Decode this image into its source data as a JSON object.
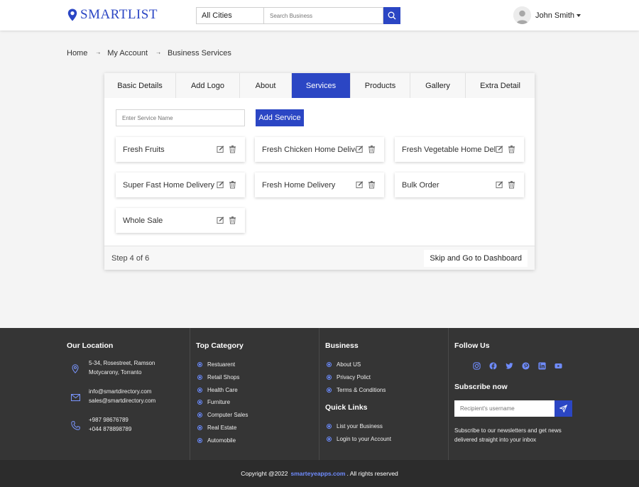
{
  "header": {
    "logo_text": "SMARTLIST",
    "city_select": "All Cities",
    "search_placeholder": "Search Business",
    "user_name": "John Smith"
  },
  "breadcrumb": [
    "Home",
    "My Account",
    "Business Services"
  ],
  "tabs": [
    {
      "label": "Basic Details",
      "active": false
    },
    {
      "label": "Add Logo",
      "active": false
    },
    {
      "label": "About",
      "active": false
    },
    {
      "label": "Services",
      "active": true
    },
    {
      "label": "Products",
      "active": false
    },
    {
      "label": "Gallery",
      "active": false
    },
    {
      "label": "Extra Detail",
      "active": false
    }
  ],
  "service_form": {
    "placeholder": "Enter Service Name",
    "add_label": "Add Service"
  },
  "services": [
    "Fresh Fruits",
    "Fresh Chicken Home Delivery",
    "Fresh Vegetable Home Delivery",
    "Super Fast Home Delivery",
    "Fresh Home Delivery",
    "Bulk Order",
    "Whole Sale"
  ],
  "card_footer": {
    "step": "Step 4 of 6",
    "skip_label": "Skip and Go to Dashboard"
  },
  "footer": {
    "location": {
      "heading": "Our Location",
      "address": [
        "5-34, Rosestreet, Ramson",
        "Motycarony, Torranto"
      ],
      "emails": [
        "info@smartdirectory.com",
        "sales@smartdirectory.com"
      ],
      "phones": [
        "+987 98676789",
        "+044 878898789"
      ]
    },
    "top_category": {
      "heading": "Top Category",
      "items": [
        "Restuarent",
        "Retail Shops",
        "Health Care",
        "Furniture",
        "Computer Sales",
        "Real Estate",
        "Automobile"
      ]
    },
    "business": {
      "heading": "Business",
      "items": [
        "About US",
        "Privacy Polict",
        "Terms & Conditions"
      ]
    },
    "quick_links": {
      "heading": "Quick Links",
      "items": [
        "List your Business",
        "Login to your Account"
      ]
    },
    "follow": {
      "heading": "Follow Us",
      "icons": [
        "instagram-icon",
        "facebook-icon",
        "twitter-icon",
        "pinterest-icon",
        "linkedin-icon",
        "youtube-icon"
      ]
    },
    "subscribe": {
      "heading": "Subscribe now",
      "placeholder": "Recipient's username",
      "text": "Subscribe to our newsletters and get news delivered straight into your inbox"
    }
  },
  "copyright": {
    "prefix": "Copyright @2022",
    "site": "smarteyeapps.com",
    "suffix": ". All rights reserved"
  },
  "colors": {
    "accent": "#2b46c4",
    "footer_bg": "#353535",
    "copyright_bg": "#2c2c2c",
    "link_accent": "#6f8cff"
  }
}
